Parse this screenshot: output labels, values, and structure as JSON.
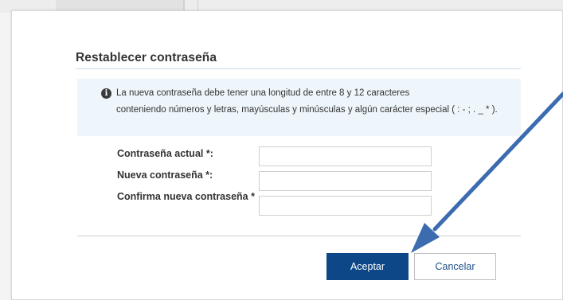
{
  "dialog": {
    "title": "Restablecer contraseña"
  },
  "info": {
    "icon": "info-circle-icon",
    "line1": "La nueva contraseña debe tener una longitud de entre 8 y 12 caracteres",
    "line2": "conteniendo números y letras, mayúsculas y minúsculas y algún carácter especial ( : - ; . _ * )."
  },
  "form": {
    "current_password_label": "Contraseña actual *:",
    "current_password_value": "",
    "new_password_label": "Nueva contraseña *:",
    "new_password_value": "",
    "confirm_password_label": "Confirma nueva contraseña *",
    "confirm_password_value": ""
  },
  "buttons": {
    "accept": "Aceptar",
    "cancel": "Cancelar"
  },
  "colors": {
    "accent": "#0e4788",
    "info_background": "#eef6fb",
    "annotation_arrow": "#3c6bb0"
  }
}
